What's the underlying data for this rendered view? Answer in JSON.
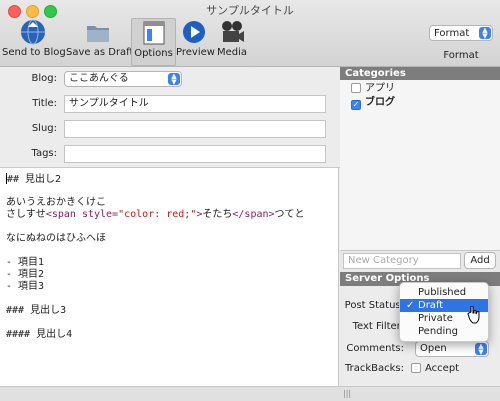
{
  "window": {
    "title": "サンプルタイトル"
  },
  "toolbar": {
    "send_to_blog": "Send to Blog",
    "save_as_draft": "Save as Draft",
    "options": "Options",
    "preview": "Preview",
    "media": "Media",
    "format_value": "Format",
    "format_caption": "Format"
  },
  "fields": {
    "blog_label": "Blog:",
    "blog_value": "ここあんぐる",
    "title_label": "Title:",
    "title_value": "サンプルタイトル",
    "slug_label": "Slug:",
    "slug_value": "",
    "tags_label": "Tags:",
    "tags_value": ""
  },
  "editor": {
    "lines": [
      "## 見出し2",
      "",
      "あいうえおかきくけこ",
      "さしすせ<span style=\"color: red;\">そたち</span>つてと",
      "",
      "なにぬねのはひふへほ",
      "",
      "- 項目1",
      "- 項目2",
      "- 項目3",
      "",
      "### 見出し3",
      "",
      "#### 見出し4"
    ]
  },
  "categories": {
    "header": "Categories",
    "items": [
      {
        "label": "アプリ",
        "checked": false
      },
      {
        "label": "ブログ",
        "checked": true
      }
    ],
    "new_category_placeholder": "New Category",
    "add_label": "Add"
  },
  "server_options": {
    "header": "Server Options",
    "post_status_label": "Post Status:",
    "text_filter_label": "Text Filter:",
    "comments_label": "Comments:",
    "comments_value": "Open",
    "trackbacks_label": "TrackBacks:",
    "accept_label": "Accept"
  },
  "popup": {
    "options": [
      "Published",
      "Draft",
      "Private",
      "Pending"
    ],
    "selected": "Draft"
  },
  "colors": {
    "accent": "#2f74e6",
    "section_header": "#7d7d7d",
    "html_tag": "#8a1d6b",
    "html_string": "#c41a16"
  }
}
